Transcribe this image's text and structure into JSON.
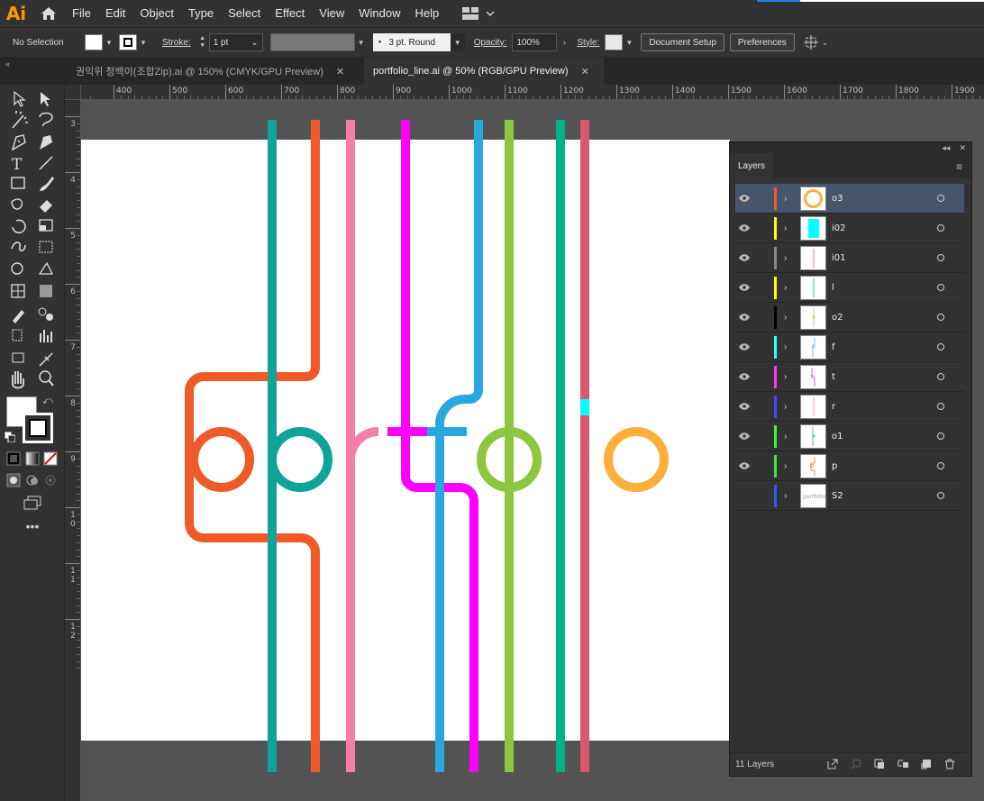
{
  "app": {
    "logo": "Ai",
    "accent": "#ff9a00"
  },
  "menu": [
    "File",
    "Edit",
    "Object",
    "Type",
    "Select",
    "Effect",
    "View",
    "Window",
    "Help"
  ],
  "control": {
    "selection": "No Selection",
    "stroke_label": "Stroke:",
    "stroke_weight": "1 pt",
    "brush": "3 pt. Round",
    "opacity_label": "Opacity:",
    "opacity": "100%",
    "style_label": "Style:",
    "document_setup": "Document Setup",
    "preferences": "Preferences"
  },
  "tabs": [
    {
      "label": "권익위 청백이(조합Zip).ai @ 150% (CMYK/GPU Preview)",
      "active": false
    },
    {
      "label": "portfolio_line.ai @ 50% (RGB/GPU Preview)",
      "active": true
    }
  ],
  "ruler": {
    "h": [
      "400",
      "500",
      "600",
      "700",
      "800",
      "900",
      "1000",
      "1100",
      "1200",
      "1300",
      "1400",
      "1500",
      "1600",
      "1700",
      "1800",
      "1900"
    ],
    "v": [
      "3",
      "4",
      "5",
      "6",
      "7",
      "8",
      "9",
      "10",
      "11",
      "12"
    ]
  },
  "artwork": {
    "word": "portfolio",
    "colors": {
      "orange": "#f05a28",
      "teal": "#0fa39b",
      "pink": "#f77ea9",
      "magenta": "#ff00ff",
      "blue": "#29a8e0",
      "green": "#8dc63f",
      "emerald": "#00b386",
      "rose": "#d9596f",
      "gold": "#fbb03b",
      "cyan": "#00ffff"
    }
  },
  "layers": {
    "title": "Layers",
    "items": [
      {
        "name": "o3",
        "color": "#f05a28",
        "visible": true,
        "selected": true
      },
      {
        "name": "i02",
        "color": "#ffff00",
        "visible": true,
        "selected": false
      },
      {
        "name": "i01",
        "color": "#888888",
        "visible": true,
        "selected": false
      },
      {
        "name": "l",
        "color": "#ffff00",
        "visible": true,
        "selected": false
      },
      {
        "name": "o2",
        "color": "#000000",
        "visible": true,
        "selected": false
      },
      {
        "name": "f",
        "color": "#33ffff",
        "visible": true,
        "selected": false
      },
      {
        "name": "t",
        "color": "#ff33ff",
        "visible": true,
        "selected": false
      },
      {
        "name": "r",
        "color": "#4444ff",
        "visible": true,
        "selected": false
      },
      {
        "name": "o1",
        "color": "#33ff33",
        "visible": true,
        "selected": false
      },
      {
        "name": "p",
        "color": "#33ee33",
        "visible": true,
        "selected": false
      },
      {
        "name": "S2",
        "color": "#3355ff",
        "visible": false,
        "selected": false
      }
    ],
    "count": "11 Layers"
  }
}
